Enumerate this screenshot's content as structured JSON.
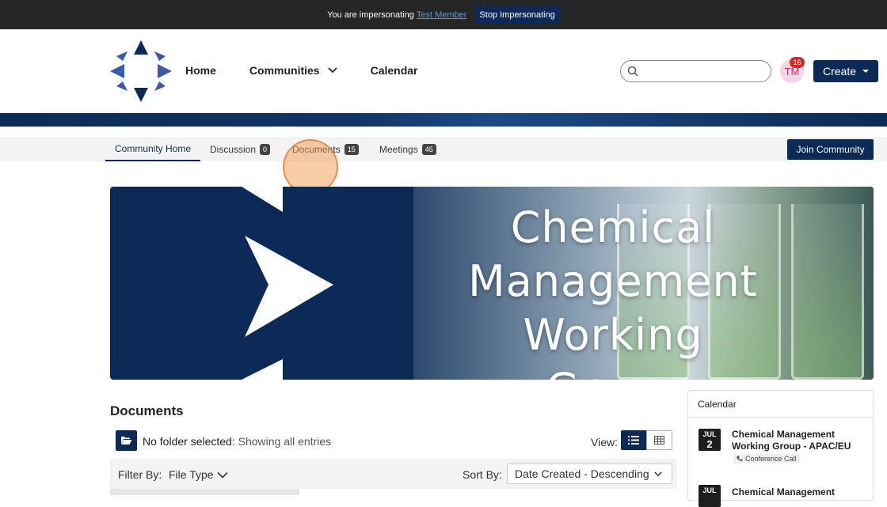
{
  "impersonation": {
    "text": "You are impersonating",
    "member": "Test Member",
    "stop_label": "Stop Impersonating"
  },
  "header": {
    "nav": [
      "Home",
      "Communities",
      "Calendar"
    ],
    "search_placeholder": "",
    "avatar_initials": "TM",
    "notification_count": "16",
    "create_label": "Create"
  },
  "subnav": {
    "tabs": [
      {
        "label": "Community Home",
        "count": null
      },
      {
        "label": "Discussion",
        "count": "0"
      },
      {
        "label": "Documents",
        "count": "15"
      },
      {
        "label": "Meetings",
        "count": "45"
      }
    ],
    "join_label": "Join Community"
  },
  "banner": {
    "title_lines": [
      "Chemical",
      "Management",
      "Working Group"
    ]
  },
  "documents": {
    "heading": "Documents",
    "folder_label": "No folder selected:",
    "folder_status": "Showing all entries",
    "view_label": "View:",
    "filter_label": "Filter By:",
    "filter_value": "File Type",
    "sort_label": "Sort By:",
    "sort_value": "Date Created - Descending"
  },
  "calendar": {
    "heading": "Calendar",
    "events": [
      {
        "month": "JUL",
        "day": "2",
        "title": "Chemical Management Working Group - APAC/EU",
        "tag": "Conference Call"
      },
      {
        "month": "JUL",
        "day": "",
        "title": "Chemical Management",
        "tag": ""
      }
    ]
  },
  "colors": {
    "brand_navy": "#0c2a57",
    "impersonation_bar": "#262626",
    "badge_red": "#e02424"
  }
}
